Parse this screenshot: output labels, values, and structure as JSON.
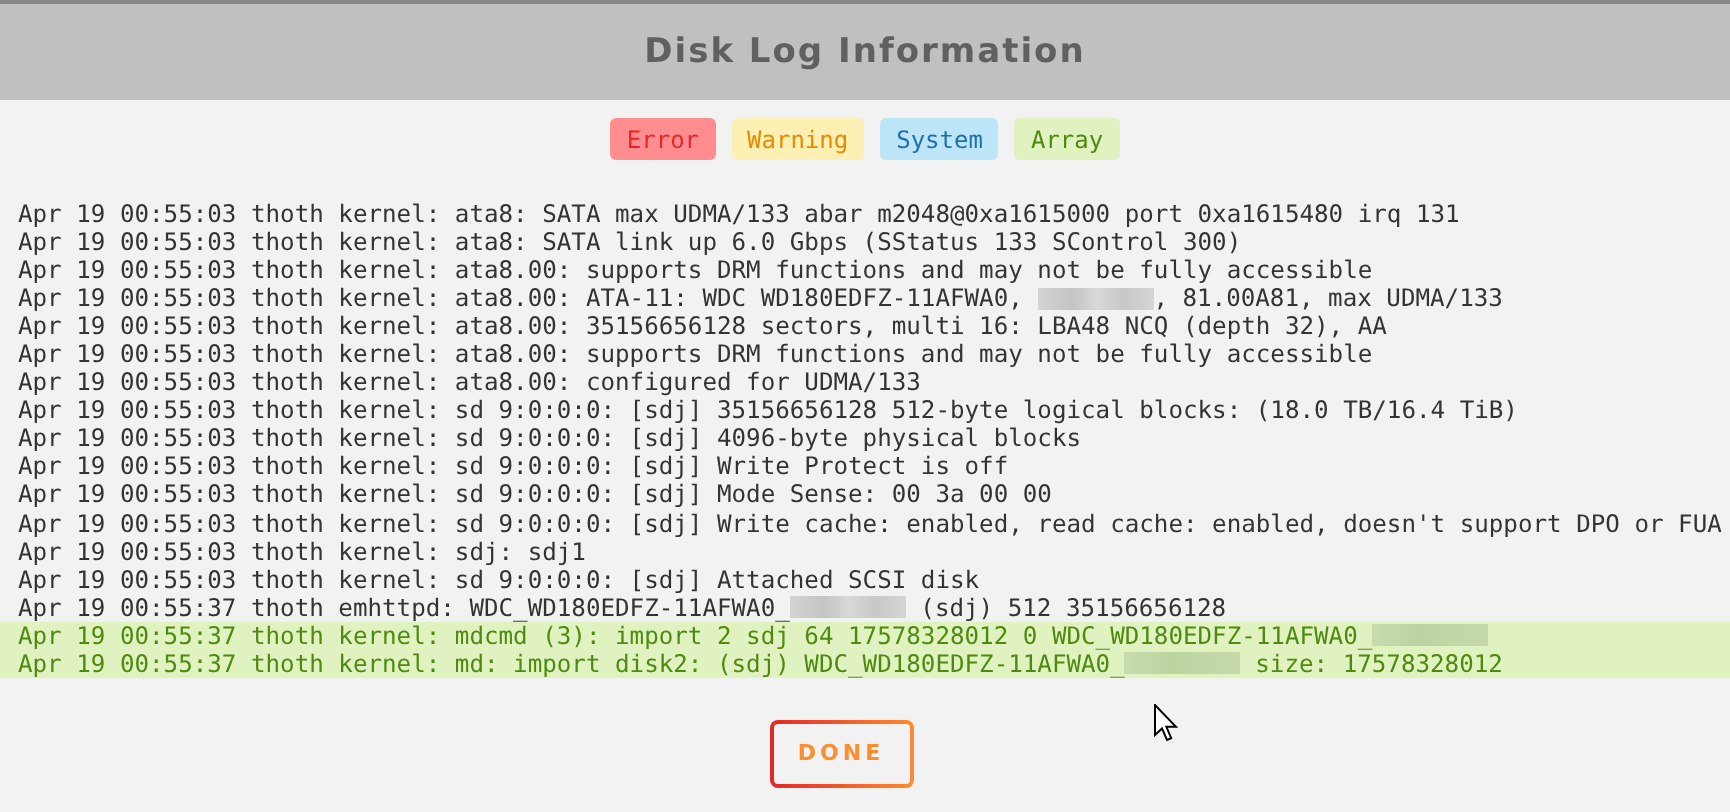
{
  "dialog": {
    "title": "Disk Log Information"
  },
  "legend": [
    {
      "label": "Error",
      "kind": "error"
    },
    {
      "label": "Warning",
      "kind": "warning"
    },
    {
      "label": "System",
      "kind": "system"
    },
    {
      "label": "Array",
      "kind": "array"
    }
  ],
  "log_lines": [
    {
      "kind": "plain",
      "segments": [
        {
          "kind": "text",
          "text": "Apr 19 00:55:03 thoth kernel: ata8: SATA max UDMA/133 abar m2048@0xa1615000 port 0xa1615480 irq 131"
        }
      ]
    },
    {
      "kind": "plain",
      "segments": [
        {
          "kind": "text",
          "text": "Apr 19 00:55:03 thoth kernel: ata8: SATA link up 6.0 Gbps (SStatus 133 SControl 300)"
        }
      ]
    },
    {
      "kind": "plain",
      "segments": [
        {
          "kind": "text",
          "text": "Apr 19 00:55:03 thoth kernel: ata8.00: supports DRM functions and may not be fully accessible"
        }
      ]
    },
    {
      "kind": "plain",
      "segments": [
        {
          "kind": "text",
          "text": "Apr 19 00:55:03 thoth kernel: ata8.00: ATA-11: WDC WD180EDFZ-11AFWA0, "
        },
        {
          "kind": "redacted"
        },
        {
          "kind": "text",
          "text": ", 81.00A81, max UDMA/133"
        }
      ]
    },
    {
      "kind": "plain",
      "segments": [
        {
          "kind": "text",
          "text": "Apr 19 00:55:03 thoth kernel: ata8.00: 35156656128 sectors, multi 16: LBA48 NCQ (depth 32), AA"
        }
      ]
    },
    {
      "kind": "plain",
      "segments": [
        {
          "kind": "text",
          "text": "Apr 19 00:55:03 thoth kernel: ata8.00: supports DRM functions and may not be fully accessible"
        }
      ]
    },
    {
      "kind": "plain",
      "segments": [
        {
          "kind": "text",
          "text": "Apr 19 00:55:03 thoth kernel: ata8.00: configured for UDMA/133"
        }
      ]
    },
    {
      "kind": "plain",
      "segments": [
        {
          "kind": "text",
          "text": "Apr 19 00:55:03 thoth kernel: sd 9:0:0:0: [sdj] 35156656128 512-byte logical blocks: (18.0 TB/16.4 TiB)"
        }
      ]
    },
    {
      "kind": "plain",
      "segments": [
        {
          "kind": "text",
          "text": "Apr 19 00:55:03 thoth kernel: sd 9:0:0:0: [sdj] 4096-byte physical blocks"
        }
      ]
    },
    {
      "kind": "plain",
      "segments": [
        {
          "kind": "text",
          "text": "Apr 19 00:55:03 thoth kernel: sd 9:0:0:0: [sdj] Write Protect is off"
        }
      ]
    },
    {
      "kind": "plain",
      "segments": [
        {
          "kind": "text",
          "text": "Apr 19 00:55:03 thoth kernel: sd 9:0:0:0: [sdj] Mode Sense: 00 3a 00 00"
        }
      ]
    },
    {
      "kind": "plain",
      "segments": [
        {
          "kind": "text",
          "text": "Apr 19 00:55:03 thoth kernel: sd 9:0:0:0: [sdj] Write cache: enabled, read cache: enabled, doesn't support DPO or FUA"
        }
      ]
    },
    {
      "kind": "plain",
      "segments": [
        {
          "kind": "text",
          "text": "Apr 19 00:55:03 thoth kernel: sdj: sdj1"
        }
      ]
    },
    {
      "kind": "plain",
      "segments": [
        {
          "kind": "text",
          "text": "Apr 19 00:55:03 thoth kernel: sd 9:0:0:0: [sdj] Attached SCSI disk"
        }
      ]
    },
    {
      "kind": "plain",
      "segments": [
        {
          "kind": "text",
          "text": "Apr 19 00:55:37 thoth emhttpd: WDC_WD180EDFZ-11AFWA0_"
        },
        {
          "kind": "redacted"
        },
        {
          "kind": "text",
          "text": " (sdj) 512 35156656128"
        }
      ]
    },
    {
      "kind": "array",
      "segments": [
        {
          "kind": "text",
          "text": "Apr 19 00:55:37 thoth kernel: mdcmd (3): import 2 sdj 64 17578328012 0 WDC_WD180EDFZ-11AFWA0_"
        },
        {
          "kind": "redacted"
        }
      ]
    },
    {
      "kind": "array",
      "segments": [
        {
          "kind": "text",
          "text": "Apr 19 00:55:37 thoth kernel: md: import disk2: (sdj) WDC_WD180EDFZ-11AFWA0_"
        },
        {
          "kind": "redacted"
        },
        {
          "kind": "text",
          "text": " size: 17578328012"
        }
      ]
    }
  ],
  "done_button": {
    "label": "DONE"
  }
}
